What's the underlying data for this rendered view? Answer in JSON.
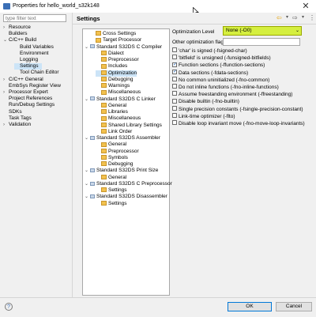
{
  "window": {
    "title": "Properties for hello_world_s32k148",
    "close": "✕"
  },
  "filter": {
    "placeholder": "type filter text"
  },
  "left_nav": [
    {
      "label": "Resource",
      "arrow": "›",
      "indent": 0
    },
    {
      "label": "Builders",
      "arrow": "",
      "indent": 0
    },
    {
      "label": "C/C++ Build",
      "arrow": "⌄",
      "indent": 0
    },
    {
      "label": "Build Variables",
      "arrow": "",
      "indent": 1
    },
    {
      "label": "Environment",
      "arrow": "",
      "indent": 1
    },
    {
      "label": "Logging",
      "arrow": "",
      "indent": 1
    },
    {
      "label": "Settings",
      "arrow": "",
      "indent": 1,
      "selected": true
    },
    {
      "label": "Tool Chain Editor",
      "arrow": "",
      "indent": 1
    },
    {
      "label": "C/C++ General",
      "arrow": "›",
      "indent": 0
    },
    {
      "label": "EmbSys Register View",
      "arrow": "",
      "indent": 0
    },
    {
      "label": "Processor Expert",
      "arrow": "›",
      "indent": 0
    },
    {
      "label": "Project References",
      "arrow": "",
      "indent": 0
    },
    {
      "label": "Run/Debug Settings",
      "arrow": "",
      "indent": 0
    },
    {
      "label": "SDKs",
      "arrow": "",
      "indent": 0
    },
    {
      "label": "Task Tags",
      "arrow": "",
      "indent": 0
    },
    {
      "label": "Validation",
      "arrow": "›",
      "indent": 0
    }
  ],
  "header": {
    "title": "Settings",
    "back": "⇦",
    "forward": "⇨",
    "menu": "⋮"
  },
  "tool_tree": [
    {
      "label": "Cross Settings",
      "icon": "prj",
      "indent": 1,
      "twisty": ""
    },
    {
      "label": "Target Processor",
      "icon": "prj",
      "indent": 1,
      "twisty": ""
    },
    {
      "label": "Standard S32DS C Compiler",
      "icon": "tool",
      "indent": 0,
      "twisty": "⌄"
    },
    {
      "label": "Dialect",
      "icon": "prj",
      "indent": 2,
      "twisty": ""
    },
    {
      "label": "Preprocessor",
      "icon": "prj",
      "indent": 2,
      "twisty": ""
    },
    {
      "label": "Includes",
      "icon": "prj",
      "indent": 2,
      "twisty": ""
    },
    {
      "label": "Optimization",
      "icon": "prj",
      "indent": 2,
      "twisty": "",
      "selected": true
    },
    {
      "label": "Debugging",
      "icon": "prj",
      "indent": 2,
      "twisty": ""
    },
    {
      "label": "Warnings",
      "icon": "prj",
      "indent": 2,
      "twisty": ""
    },
    {
      "label": "Miscellaneous",
      "icon": "prj",
      "indent": 2,
      "twisty": ""
    },
    {
      "label": "Standard S32DS C Linker",
      "icon": "tool",
      "indent": 0,
      "twisty": "⌄"
    },
    {
      "label": "General",
      "icon": "prj",
      "indent": 2,
      "twisty": ""
    },
    {
      "label": "Libraries",
      "icon": "prj",
      "indent": 2,
      "twisty": ""
    },
    {
      "label": "Miscellaneous",
      "icon": "prj",
      "indent": 2,
      "twisty": ""
    },
    {
      "label": "Shared Library Settings",
      "icon": "prj",
      "indent": 2,
      "twisty": ""
    },
    {
      "label": "Link Order",
      "icon": "prj",
      "indent": 2,
      "twisty": ""
    },
    {
      "label": "Standard S32DS Assembler",
      "icon": "tool",
      "indent": 0,
      "twisty": "⌄"
    },
    {
      "label": "General",
      "icon": "prj",
      "indent": 2,
      "twisty": ""
    },
    {
      "label": "Preprocessor",
      "icon": "prj",
      "indent": 2,
      "twisty": ""
    },
    {
      "label": "Symbols",
      "icon": "prj",
      "indent": 2,
      "twisty": ""
    },
    {
      "label": "Debugging",
      "icon": "prj",
      "indent": 2,
      "twisty": ""
    },
    {
      "label": "Standard S32DS Print Size",
      "icon": "tool",
      "indent": 0,
      "twisty": "⌄"
    },
    {
      "label": "General",
      "icon": "prj",
      "indent": 2,
      "twisty": ""
    },
    {
      "label": "Standard S32DS C Preprocessor",
      "icon": "tool",
      "indent": 0,
      "twisty": "⌄"
    },
    {
      "label": "Settings",
      "icon": "prj",
      "indent": 2,
      "twisty": ""
    },
    {
      "label": "Standard S32DS Disassembler",
      "icon": "tool",
      "indent": 0,
      "twisty": "⌄"
    },
    {
      "label": "Settings",
      "icon": "prj",
      "indent": 2,
      "twisty": ""
    }
  ],
  "settings": {
    "optimization_level_label": "Optimization Level",
    "optimization_level_value": "None (-O0)",
    "other_flags_label": "Other optimization flags",
    "other_flags_value": ""
  },
  "options": [
    {
      "label": "'char' is signed (-fsigned-char)",
      "checked": false
    },
    {
      "label": "'bitfield' is unsigned (-funsigned-bitfields)",
      "checked": false
    },
    {
      "label": "Function sections (-ffunction-sections)",
      "checked": true
    },
    {
      "label": "Data sections (-fdata-sections)",
      "checked": true
    },
    {
      "label": "No common uninitialized (-fno-common)",
      "checked": false
    },
    {
      "label": "Do not inline functions (-fno-inline-functions)",
      "checked": false
    },
    {
      "label": "Assume freestanding environment (-ffreestanding)",
      "checked": false
    },
    {
      "label": "Disable builtin (-fno-builtin)",
      "checked": false
    },
    {
      "label": "Single precision constants (-fsingle-precision-constant)",
      "checked": false
    },
    {
      "label": "Link-time optimizer (-flto)",
      "checked": false
    },
    {
      "label": "Disable loop invariant move (-fno-move-loop-invariants)",
      "checked": false
    }
  ],
  "buttons": {
    "help": "?",
    "ok": "OK",
    "cancel": "Cancel"
  },
  "colors": {
    "highlight": "#d5ef3f",
    "selection": "#cce4f7"
  }
}
